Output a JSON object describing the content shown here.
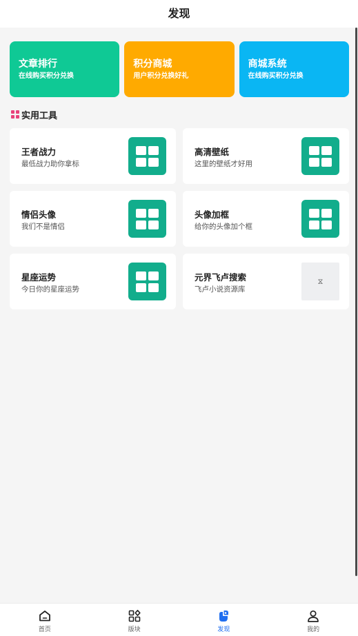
{
  "header": {
    "title": "发现"
  },
  "banners": [
    {
      "title": "文章排行",
      "subtitle": "在线购买积分兑换",
      "color": "#0fc995"
    },
    {
      "title": "积分商城",
      "subtitle": "用户积分兑换好礼",
      "color": "#ffaa00"
    },
    {
      "title": "商城系统",
      "subtitle": "在线购买积分兑换",
      "color": "#0ab6f3"
    }
  ],
  "section": {
    "title": "实用工具",
    "icon": "grid-icon",
    "icon_color": "#e8427b"
  },
  "tools": [
    {
      "name": "王者战力",
      "desc": "最低战力助你拿标",
      "icon": "grid-icon"
    },
    {
      "name": "高清壁纸",
      "desc": "这里的壁纸才好用",
      "icon": "grid-icon"
    },
    {
      "name": "情侣头像",
      "desc": "我们不是情侣",
      "icon": "grid-icon"
    },
    {
      "name": "头像加框",
      "desc": "给你的头像加个框",
      "icon": "grid-icon"
    },
    {
      "name": "星座运势",
      "desc": "今日你的星座运势",
      "icon": "grid-icon"
    },
    {
      "name": "元界飞卢搜索",
      "desc": "飞卢小说资源库",
      "icon": "hourglass-icon"
    }
  ],
  "tool_icon_color": "#12ad8c",
  "tabbar": {
    "items": [
      {
        "label": "首页",
        "icon": "home-icon",
        "active": false
      },
      {
        "label": "版块",
        "icon": "blocks-icon",
        "active": false
      },
      {
        "label": "发现",
        "icon": "discover-icon",
        "active": true
      },
      {
        "label": "我的",
        "icon": "user-icon",
        "active": false
      }
    ],
    "active_color": "#1f6ef0"
  }
}
